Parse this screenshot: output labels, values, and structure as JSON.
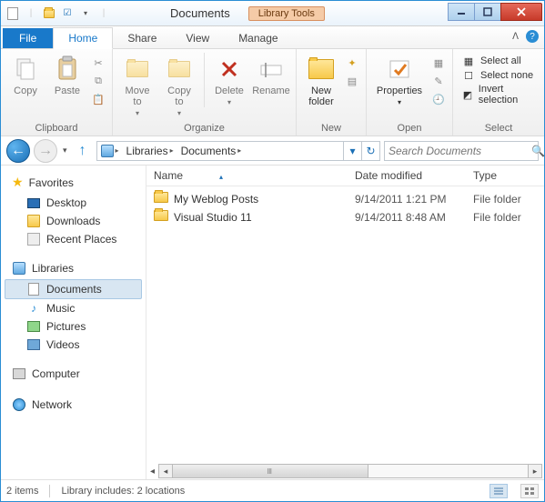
{
  "titlebar": {
    "title": "Documents",
    "contextTab": "Library Tools"
  },
  "tabs": {
    "file": "File",
    "home": "Home",
    "share": "Share",
    "view": "View",
    "manage": "Manage"
  },
  "ribbon": {
    "clipboard": {
      "label": "Clipboard",
      "copy": "Copy",
      "paste": "Paste"
    },
    "organize": {
      "label": "Organize",
      "moveTo": "Move\nto",
      "copyTo": "Copy\nto",
      "delete": "Delete",
      "rename": "Rename"
    },
    "new": {
      "label": "New",
      "newFolder": "New\nfolder"
    },
    "open": {
      "label": "Open",
      "properties": "Properties"
    },
    "select": {
      "label": "Select",
      "all": "Select all",
      "none": "Select none",
      "invert": "Invert selection"
    }
  },
  "address": {
    "root": "Libraries",
    "current": "Documents"
  },
  "search": {
    "placeholder": "Search Documents"
  },
  "sidebar": {
    "favorites": "Favorites",
    "desktop": "Desktop",
    "downloads": "Downloads",
    "recent": "Recent Places",
    "libraries": "Libraries",
    "documents": "Documents",
    "music": "Music",
    "pictures": "Pictures",
    "videos": "Videos",
    "computer": "Computer",
    "network": "Network"
  },
  "columns": {
    "name": "Name",
    "date": "Date modified",
    "type": "Type"
  },
  "files": [
    {
      "name": "My Weblog Posts",
      "date": "9/14/2011 1:21 PM",
      "type": "File folder"
    },
    {
      "name": "Visual Studio 11",
      "date": "9/14/2011 8:48 AM",
      "type": "File folder"
    }
  ],
  "status": {
    "items": "2 items",
    "includes": "Library includes: 2 locations"
  }
}
